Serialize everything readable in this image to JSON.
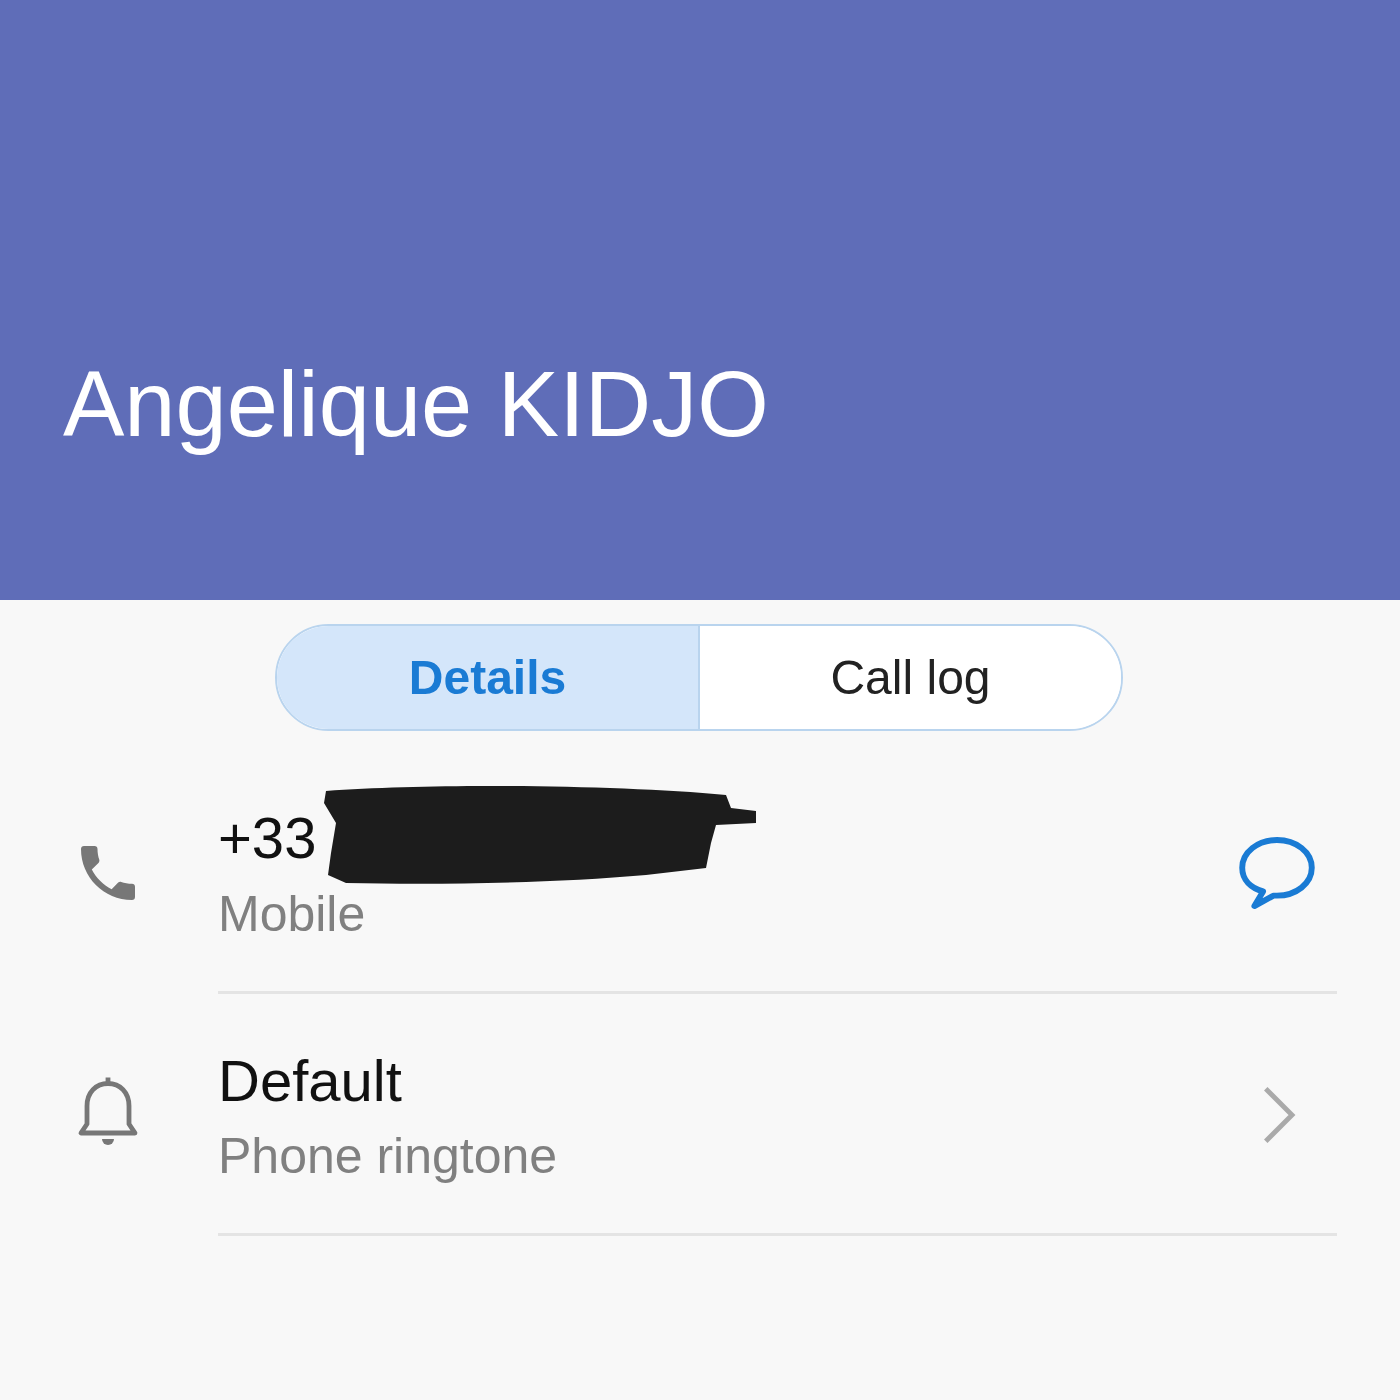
{
  "header": {
    "name": "Angelique KIDJO"
  },
  "tabs": [
    {
      "label": "Details",
      "selected": true
    },
    {
      "label": "Call log",
      "selected": false
    }
  ],
  "rows": [
    {
      "kind": "phone",
      "title": "+33",
      "subtitle": "Mobile",
      "redacted": true
    },
    {
      "kind": "ringtone",
      "title": "Default",
      "subtitle": "Phone ringtone",
      "redacted": false
    }
  ]
}
